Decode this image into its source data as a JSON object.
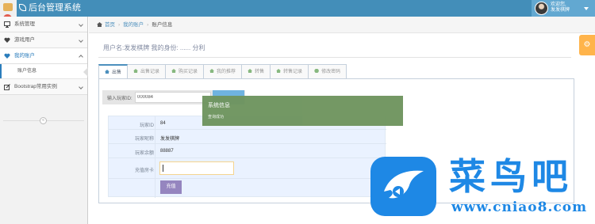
{
  "brand": {
    "title": "后台管理系统"
  },
  "user": {
    "welcome": "欢迎您,",
    "name": "发发棋牌"
  },
  "sidebar": {
    "items": [
      {
        "label": "系统管理",
        "icon": "desktop-icon"
      },
      {
        "label": "游戏用户",
        "icon": "heart-icon"
      },
      {
        "label": "我的账户",
        "icon": "heart-icon",
        "open": true
      },
      {
        "label": "Bootstrap常用实例",
        "icon": "edit-icon"
      }
    ],
    "submenu": {
      "label": "账户信息"
    },
    "collapse_glyph": "«"
  },
  "breadcrumb": {
    "home": "首页",
    "parent": "我的账户",
    "current": "账户信息"
  },
  "header": {
    "text": "用户名:发发棋牌 我的身份: ...... 分利"
  },
  "tabs": [
    {
      "label": "出售",
      "active": true
    },
    {
      "label": "出售记录"
    },
    {
      "label": "购买记录"
    },
    {
      "label": "我的推荐"
    },
    {
      "label": "转售"
    },
    {
      "label": "转售记录"
    },
    {
      "label": "修改密码",
      "icon": "key-icon"
    }
  ],
  "search": {
    "label": "输入玩家ID:",
    "value": "000084"
  },
  "player": {
    "rows": [
      {
        "label": "玩家ID",
        "value": "84"
      },
      {
        "label": "玩家昵称",
        "value": "发发棋牌"
      },
      {
        "label": "玩家余额",
        "value": "88887"
      },
      {
        "label": "充值房卡",
        "value": ""
      }
    ],
    "recharge_label": "充值"
  },
  "toast": {
    "title": "系统信息",
    "message": "查询成功"
  },
  "watermark": {
    "name": "菜鸟吧",
    "url": "www.cniao8.com"
  },
  "colors": {
    "navbar": "#438eb9",
    "accent": "#4c8fbd",
    "toast": "#6f955f",
    "recharge_button": "#9585bf",
    "settings": "#ffb44b",
    "watermark": "#1e88e5"
  }
}
